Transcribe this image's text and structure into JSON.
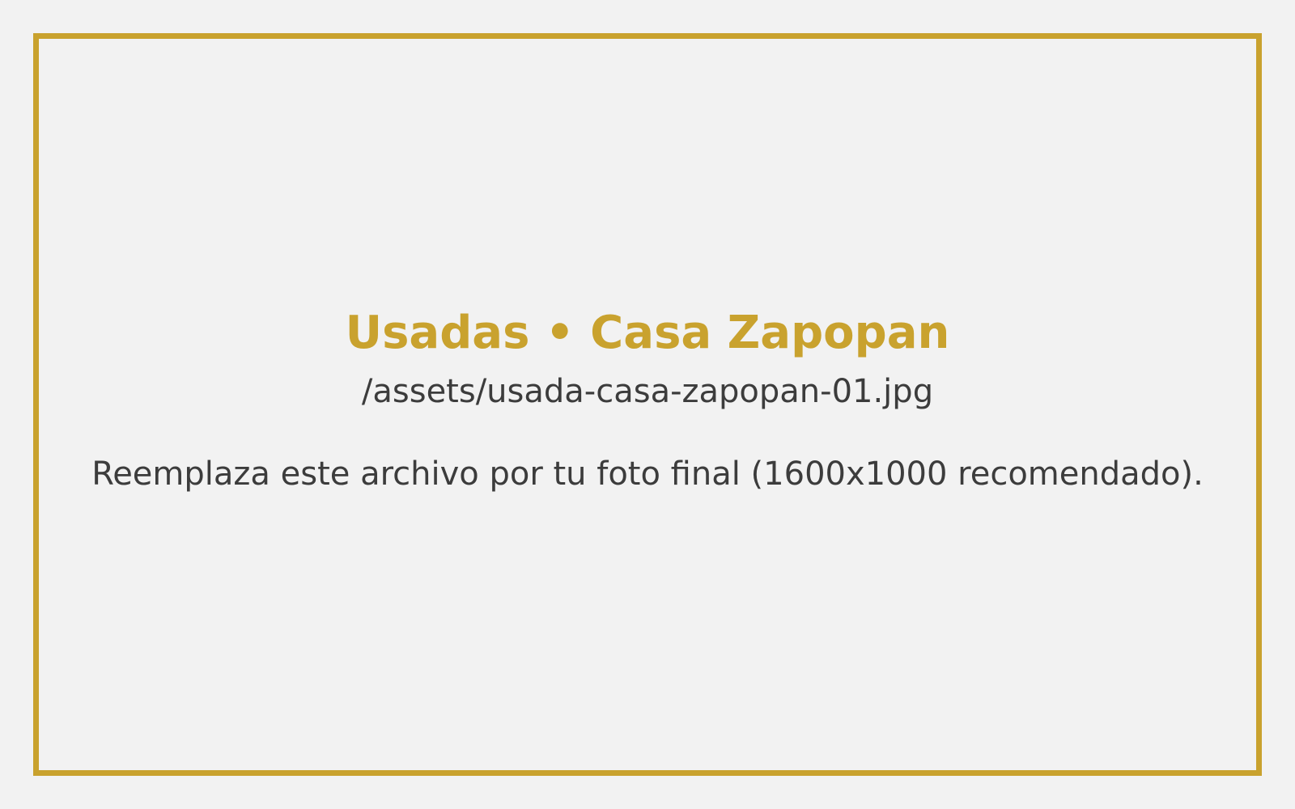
{
  "placeholder": {
    "title": "Usadas • Casa Zapopan",
    "file_path": "/assets/usada-casa-zapopan-01.jpg",
    "note": "Reemplaza este archivo por tu foto final (1600x1000 recomendado)."
  },
  "colors": {
    "background": "#f2f2f2",
    "accent": "#c9a22e",
    "text": "#3c3c3c"
  }
}
